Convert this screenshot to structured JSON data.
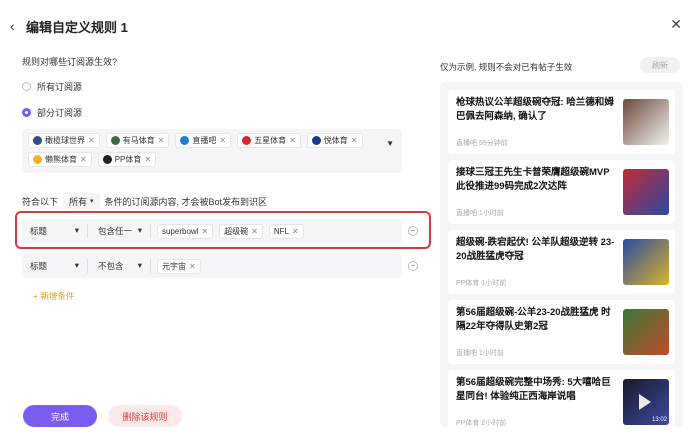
{
  "header": {
    "back": "‹",
    "title": "编辑自定义规则 1",
    "close": "✕"
  },
  "scope": {
    "question": "规则对哪些订阅源生效?",
    "options": [
      {
        "label": "所有订阅源",
        "checked": false
      },
      {
        "label": "部分订阅源",
        "checked": true
      }
    ]
  },
  "sources": [
    {
      "label": "橄榄球世界",
      "color": "#2f4f8a"
    },
    {
      "label": "有马体育",
      "color": "#3d6b3d"
    },
    {
      "label": "直播吧",
      "color": "#1e7ad6"
    },
    {
      "label": "五星体育",
      "color": "#d8262c"
    },
    {
      "label": "悦体育",
      "color": "#1a3a8a"
    },
    {
      "label": "懒熊体育",
      "color": "#f2b21c"
    },
    {
      "label": "PP体育",
      "color": "#222222"
    }
  ],
  "condition": {
    "prefix": "符合以下",
    "mode": "所有",
    "suffix": "条件的订阅源内容, 才会被Bot发布到识区"
  },
  "rules": [
    {
      "field": "标题",
      "operator": "包含任一",
      "values": [
        "superbowl",
        "超级碗",
        "NFL"
      ]
    },
    {
      "field": "标题",
      "operator": "不包含",
      "values": [
        "元宇宙"
      ]
    }
  ],
  "add_condition": "+ 新增条件",
  "buttons": {
    "done": "完成",
    "delete": "删除该规则"
  },
  "preview": {
    "note": "仅为示例, 规则不会对已有帖子生效",
    "refresh": "刷新",
    "items": [
      {
        "title": "枪球热议公羊超级碗夺冠: 哈兰德和姆巴佩去阿森纳, 确认了",
        "source": "直播吧",
        "time": "59分钟前",
        "thumb": "#6b4a3a",
        "thumb2": "#f2f2f2"
      },
      {
        "title": "接球三冠王先生卡普荣膺超级碗MVP 此役推进99码完成2次达阵",
        "source": "直播吧",
        "time": "1小时前",
        "thumb": "#c22b3a",
        "thumb2": "#2a4aa0"
      },
      {
        "title": "超级碗-跌宕起伏! 公羊队超级逆转 23-20战胜猛虎夺冠",
        "source": "PP体育",
        "time": "1小时前",
        "thumb": "#2a4aa0",
        "thumb2": "#d8b428"
      },
      {
        "title": "第56届超级碗-公羊23-20战胜猛虎 时隔22年夺得队史第2冠",
        "source": "直播吧",
        "time": "1小时前",
        "thumb": "#3a7a3a",
        "thumb2": "#c24a2a"
      },
      {
        "title": "第56届超级碗完整中场秀: 5大嘻哈巨星同台! 体验纯正西海岸说唱",
        "source": "PP体育",
        "time": "2小时前",
        "thumb": "#1a1a2a",
        "thumb2": "#3a4aa0",
        "duration": "13:02"
      }
    ]
  }
}
